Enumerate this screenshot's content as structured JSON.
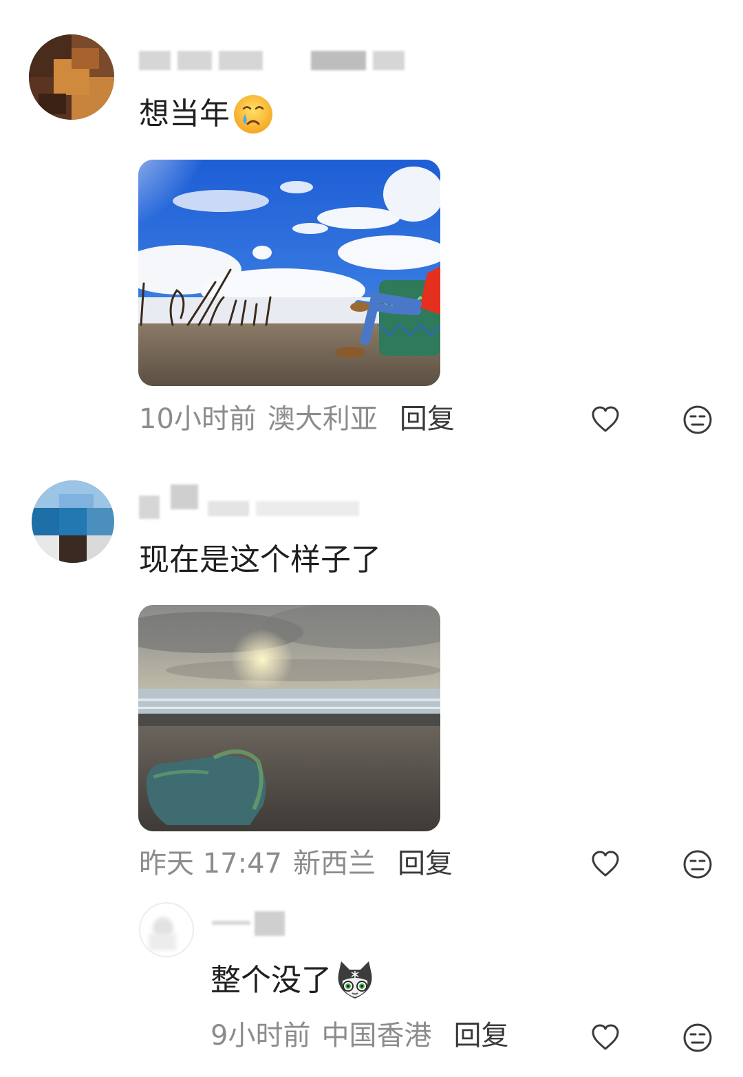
{
  "comments": [
    {
      "text": "想当年",
      "emoji": "crying-face",
      "time": "10小时前",
      "location": "澳大利亚",
      "reply_label": "回复"
    },
    {
      "text": "现在是这个样子了",
      "time": "昨天 17:47",
      "location": "新西兰",
      "reply_label": "回复"
    }
  ],
  "reply": {
    "text": "整个没了",
    "emoji": "cat-face",
    "time": "9小时前",
    "location": "中国香港",
    "reply_label": "回复"
  },
  "icons": {
    "like": "heart-icon",
    "dislike": "meh-face-icon"
  },
  "colors": {
    "text": "#1f1f1f",
    "meta": "#8c8c8c",
    "reply_link": "#3a3a3a",
    "icon": "#3a3a3a"
  }
}
